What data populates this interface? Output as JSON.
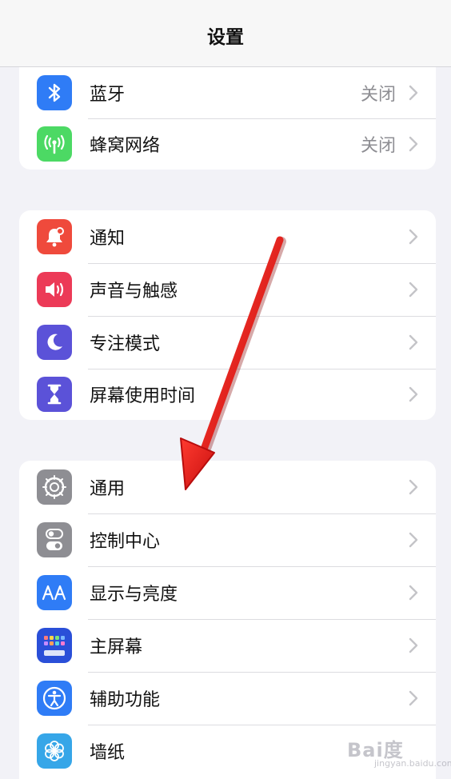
{
  "navbar": {
    "title": "设置"
  },
  "groups": [
    [
      {
        "label": "蓝牙",
        "value": "关闭",
        "icon": "bluetooth-icon",
        "color": "#2f7cf6"
      },
      {
        "label": "蜂窝网络",
        "value": "关闭",
        "icon": "antenna-icon",
        "color": "#4cd964"
      }
    ],
    [
      {
        "label": "通知",
        "icon": "notification-bell-icon",
        "color": "#ef4a3c"
      },
      {
        "label": "声音与触感",
        "icon": "speaker-icon",
        "color": "#ec3a57"
      },
      {
        "label": "专注模式",
        "icon": "moon-icon",
        "color": "#5b52d8"
      },
      {
        "label": "屏幕使用时间",
        "icon": "hourglass-icon",
        "color": "#5b52d8"
      }
    ],
    [
      {
        "label": "通用",
        "icon": "gear-icon",
        "color": "#8e8e93"
      },
      {
        "label": "控制中心",
        "icon": "toggles-icon",
        "color": "#8e8e93"
      },
      {
        "label": "显示与亮度",
        "icon": "text-size-icon",
        "color": "#2f7cf6"
      },
      {
        "label": "主屏幕",
        "icon": "home-grid-icon",
        "color": "#2a4fd8"
      },
      {
        "label": "辅助功能",
        "icon": "accessibility-icon",
        "color": "#2f7cf6"
      },
      {
        "label": "墙纸",
        "icon": "flower-icon",
        "color": "#36a6e8"
      }
    ]
  ],
  "annotation": {
    "arrow_color": "#e01b1b"
  },
  "watermark": {
    "main": "Bai度",
    "sub": "jingyan.baidu.com"
  }
}
